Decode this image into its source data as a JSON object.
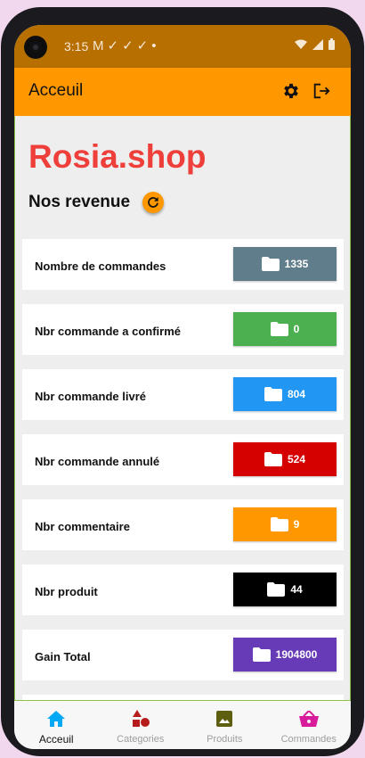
{
  "status_bar": {
    "time": "3:15",
    "notification_icons": [
      "gmail-icon",
      "check-icon",
      "check-icon",
      "check-icon",
      "dot-icon"
    ],
    "system_icons": [
      "wifi-icon",
      "signal-icon",
      "battery-icon"
    ]
  },
  "app_bar": {
    "title": "Acceuil",
    "background": "#ff9800",
    "actions": [
      "gear-icon",
      "logout-icon"
    ]
  },
  "brand": {
    "name": "Rosia.shop",
    "color": "#ef3f3b"
  },
  "section": {
    "title": "Nos revenue",
    "refresh_icon": "refresh-icon"
  },
  "stats": [
    {
      "label": "Nombre de commandes",
      "value": "1335",
      "color": "#607d8b"
    },
    {
      "label": "Nbr commande a confirmé",
      "value": "0",
      "color": "#4caf50"
    },
    {
      "label": "Nbr commande livré",
      "value": "804",
      "color": "#2196f3"
    },
    {
      "label": "Nbr commande annulé",
      "value": "524",
      "color": "#d50000"
    },
    {
      "label": "Nbr commentaire",
      "value": "9",
      "color": "#ff9800"
    },
    {
      "label": "Nbr produit",
      "value": "44",
      "color": "#000000"
    },
    {
      "label": "Gain Total",
      "value": "1904800",
      "color": "#673ab7"
    }
  ],
  "bottom_nav": [
    {
      "label": "Acceuil",
      "icon": "home-icon",
      "icon_color": "#03a9f4",
      "active": true
    },
    {
      "label": "Categories",
      "icon": "categories-icon",
      "icon_color": "#b71c1c",
      "active": false
    },
    {
      "label": "Produits",
      "icon": "image-icon",
      "icon_color": "#5d5e0f",
      "active": false
    },
    {
      "label": "Commandes",
      "icon": "basket-icon",
      "icon_color": "#d81b9b",
      "active": false
    }
  ]
}
